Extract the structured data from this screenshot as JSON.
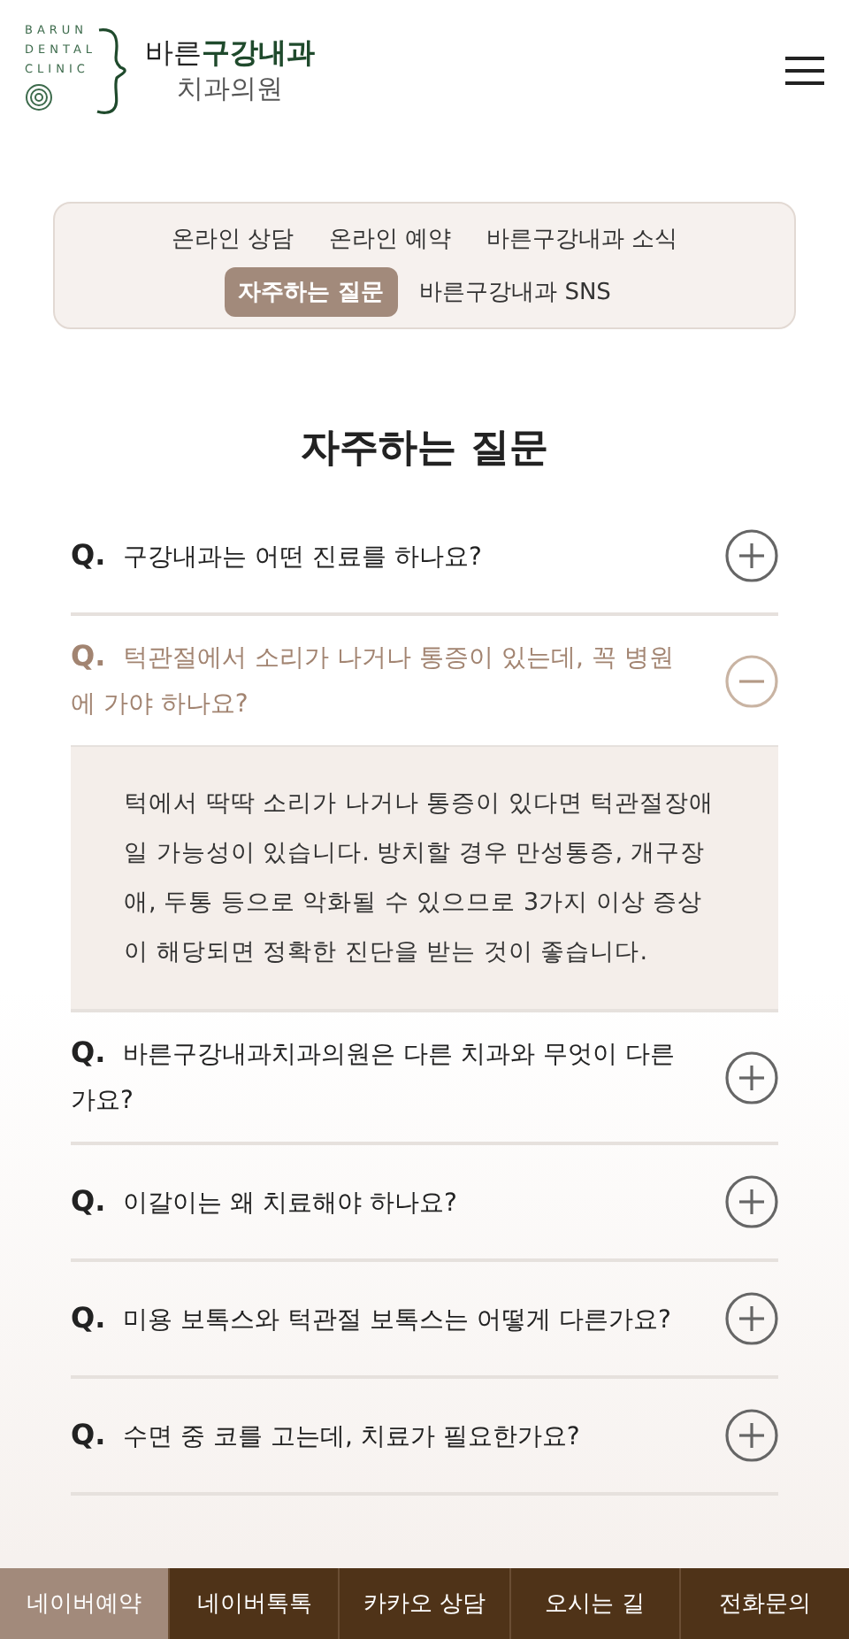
{
  "header": {
    "logo_lines": [
      "BARUN",
      "DENTAL",
      "CLINIC"
    ],
    "name": "바른**구강내과**",
    "subname": "치과의원"
  },
  "nav": [
    {
      "label": "온라인 상담",
      "selected": false
    },
    {
      "label": "온라인 예약",
      "selected": false
    },
    {
      "label": "바른구강내과 소식",
      "selected": false
    },
    {
      "label": "자주하는 질문",
      "selected": true
    },
    {
      "label": "바른구강내과 SNS",
      "selected": false
    }
  ],
  "title": "자주하는 질문",
  "faq": [
    {
      "q": "Q.",
      "question": "구강내과는 어떤 진료를 하나요?",
      "expanded": false
    },
    {
      "q": "Q.",
      "question": "턱관절에서 소리가 나거나 통증이 있는데, 꼭 병원에 가야 하나요?",
      "expanded": true,
      "answer": "턱에서 딱딱 소리가 나거나 통증이 있다면 턱관절장애일 가능성이 있습니다. 방치할 경우 만성통증, 개구장애, 두통 등으로 악화될 수 있으므로 3가지 이상 증상이 해당되면 정확한 진단을 받는 것이 좋습니다."
    },
    {
      "q": "Q.",
      "question": "바른구강내과치과의원은 다른 치과와 무엇이 다른가요?",
      "expanded": false
    },
    {
      "q": "Q.",
      "question": "이갈이는 왜 치료해야 하나요?",
      "expanded": false
    },
    {
      "q": "Q.",
      "question": "미용 보톡스와 턱관절 보톡스는 어떻게 다른가요?",
      "expanded": false
    },
    {
      "q": "Q.",
      "question": "수면 중 코를 고는데, 치료가 필요한가요?",
      "expanded": false
    }
  ],
  "bottom_bar": [
    {
      "label": "네이버예약",
      "selected": true
    },
    {
      "label": "네이버톡톡",
      "selected": false
    },
    {
      "label": "카카오 상담",
      "selected": false
    },
    {
      "label": "오시는 길",
      "selected": false
    },
    {
      "label": "전화문의",
      "selected": false
    }
  ]
}
